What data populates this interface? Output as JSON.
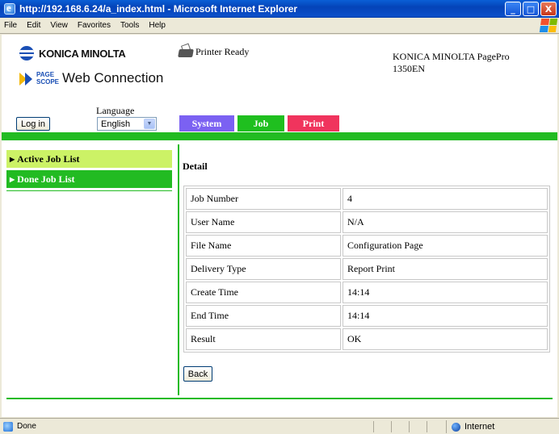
{
  "window": {
    "title": "http://192.168.6.24/a_index.html - Microsoft Internet Explorer",
    "controls": [
      "_",
      "□",
      "X"
    ]
  },
  "menu": [
    "File",
    "Edit",
    "View",
    "Favorites",
    "Tools",
    "Help"
  ],
  "header": {
    "brand": "KONICA MINOLTA",
    "product_page": "PAGE",
    "product_scope": "SCOPE",
    "product": "Web Connection",
    "printer_status": "Printer Ready",
    "model_line1": "KONICA MINOLTA PagePro",
    "model_line2": "1350EN"
  },
  "controls": {
    "language_label": "Language",
    "login_label": "Log in",
    "language_value": "English"
  },
  "tabs": [
    {
      "label": "System",
      "color": "#7b61f2"
    },
    {
      "label": "Job",
      "color": "#1fbf1f"
    },
    {
      "label": "Print",
      "color": "#f0345d"
    }
  ],
  "sidebar": {
    "items": [
      {
        "label": "Active Job List"
      },
      {
        "label": "Done Job List"
      }
    ]
  },
  "detail": {
    "title": "Detail",
    "rows": [
      {
        "label": "Job Number",
        "value": "4"
      },
      {
        "label": "User Name",
        "value": "N/A"
      },
      {
        "label": "File Name",
        "value": "Configuration Page"
      },
      {
        "label": "Delivery Type",
        "value": "Report Print"
      },
      {
        "label": "Create Time",
        "value": "14:14"
      },
      {
        "label": "End Time",
        "value": "14:14"
      },
      {
        "label": "Result",
        "value": "OK"
      }
    ],
    "back_label": "Back"
  },
  "statusbar": {
    "text": "Done",
    "zone": "Internet"
  },
  "colors": {
    "accent_green": "#22bb22",
    "active_item": "#ccf266"
  }
}
